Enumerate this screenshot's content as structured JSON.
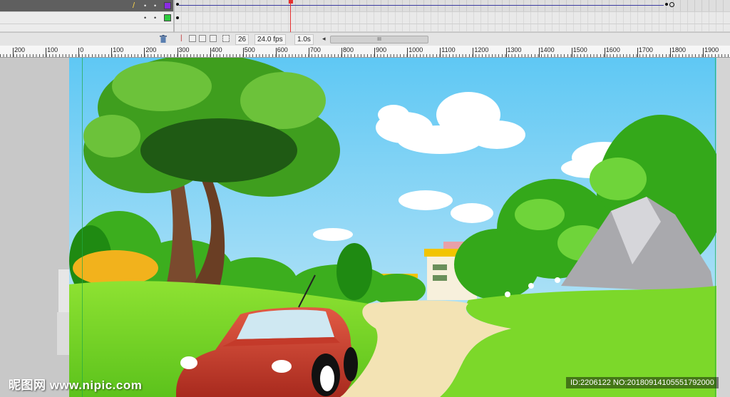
{
  "timeline": {
    "current_frame": "26",
    "fps": "24.0 fps",
    "time": "1.0s",
    "scroll_grip": "III",
    "layers": [
      {
        "swatch_color": "#8a2be2",
        "dots": [
          "•",
          "•"
        ]
      },
      {
        "swatch_color": "#2ecc40",
        "dots": [
          "•",
          "•"
        ]
      }
    ]
  },
  "ruler": {
    "labels": [
      "200",
      "100",
      "0",
      "100",
      "200",
      "300",
      "400",
      "500",
      "600",
      "700",
      "800",
      "900",
      "1000",
      "1100",
      "1200",
      "1300",
      "1400",
      "1500",
      "1600",
      "1700",
      "1800",
      "1900"
    ]
  },
  "watermark": {
    "left": "昵图网 www.nipic.com",
    "right": "ID:2206122 NO:20180914105551792000"
  },
  "icons": {
    "pencil": "pencil-icon",
    "trash": "trash-icon",
    "playhead": "playhead-icon"
  }
}
